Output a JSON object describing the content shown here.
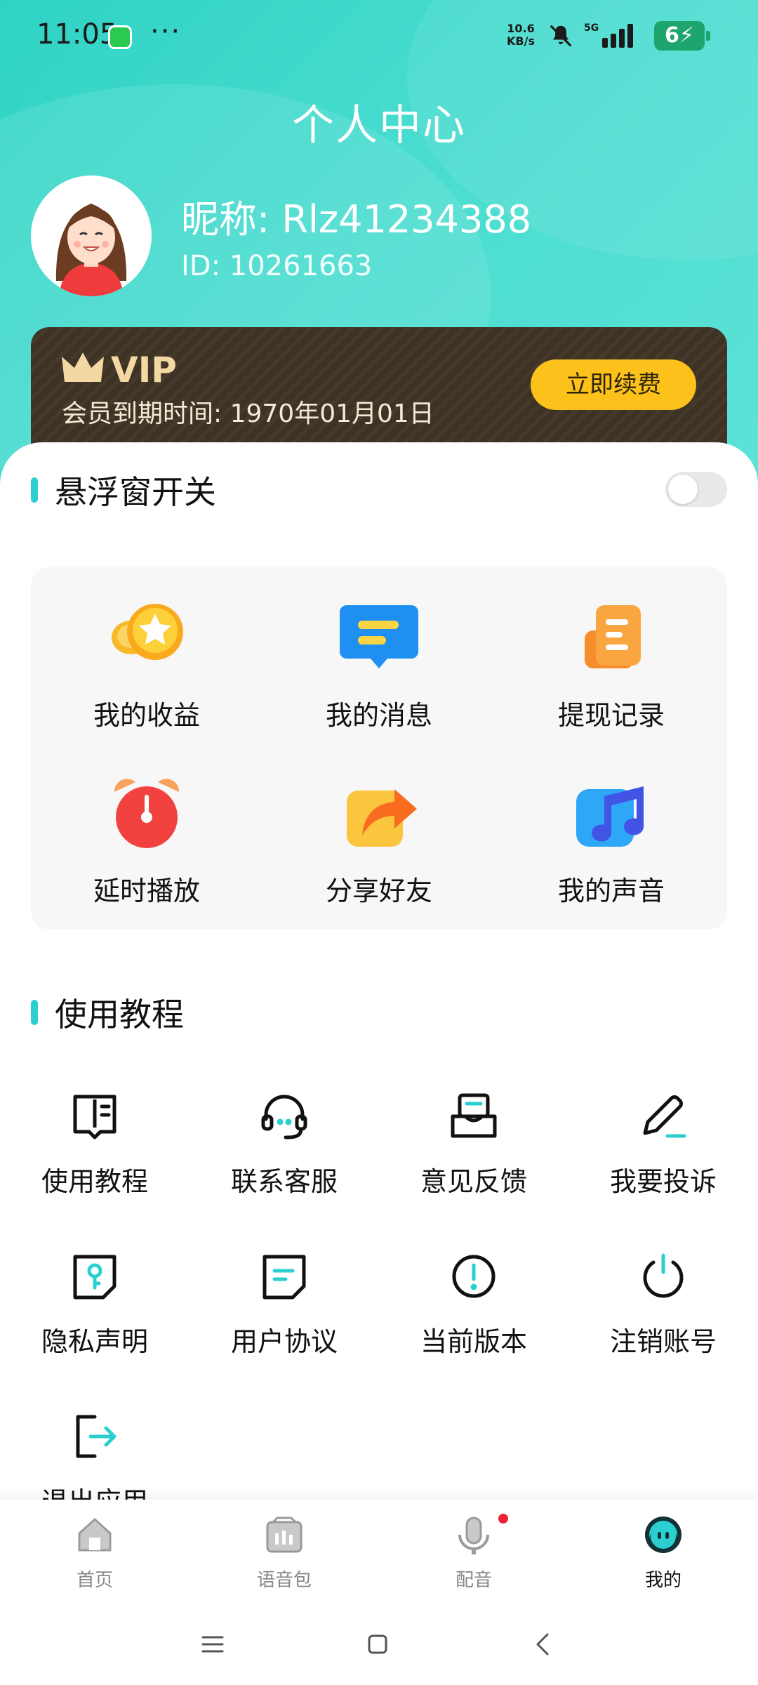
{
  "status_bar": {
    "time": "11:05",
    "more": "···",
    "net_speed_value": "10.6",
    "net_speed_unit": "KB/s",
    "network": "5G",
    "battery": "6"
  },
  "header": {
    "title": "个人中心"
  },
  "profile": {
    "nickname": "昵称: Rlz41234388",
    "user_id": "ID: 10261663"
  },
  "vip": {
    "logo_text": "VIP",
    "expire_text": "会员到期时间: 1970年01月01日",
    "renew_label": "立即续费",
    "colors": {
      "card": "#3d3223",
      "button": "#fcc21b",
      "crown": "#f3d8a3"
    }
  },
  "floating_window": {
    "label": "悬浮窗开关",
    "enabled": false
  },
  "features": [
    {
      "label": "我的收益",
      "icon": "coins-icon"
    },
    {
      "label": "我的消息",
      "icon": "message-icon"
    },
    {
      "label": "提现记录",
      "icon": "records-icon"
    },
    {
      "label": "延时播放",
      "icon": "alarm-clock-icon"
    },
    {
      "label": "分享好友",
      "icon": "share-icon"
    },
    {
      "label": "我的声音",
      "icon": "music-note-icon"
    }
  ],
  "tutorial_section": {
    "title": "使用教程",
    "items": [
      {
        "label": "使用教程",
        "icon": "book-icon"
      },
      {
        "label": "联系客服",
        "icon": "headset-icon"
      },
      {
        "label": "意见反馈",
        "icon": "feedback-inbox-icon"
      },
      {
        "label": "我要投诉",
        "icon": "pencil-icon"
      },
      {
        "label": "隐私声明",
        "icon": "key-icon"
      },
      {
        "label": "用户协议",
        "icon": "document-icon"
      },
      {
        "label": "当前版本",
        "icon": "info-icon"
      },
      {
        "label": "注销账号",
        "icon": "power-icon"
      },
      {
        "label": "退出应用",
        "icon": "logout-icon"
      }
    ]
  },
  "tab_bar": {
    "tabs": [
      {
        "label": "首页",
        "icon": "home-icon",
        "active": false
      },
      {
        "label": "语音包",
        "icon": "voice-pack-icon",
        "active": false
      },
      {
        "label": "配音",
        "icon": "microphone-icon",
        "active": false,
        "badge": true
      },
      {
        "label": "我的",
        "icon": "profile-face-icon",
        "active": true
      }
    ]
  },
  "accent_color": "#2bcfcf"
}
